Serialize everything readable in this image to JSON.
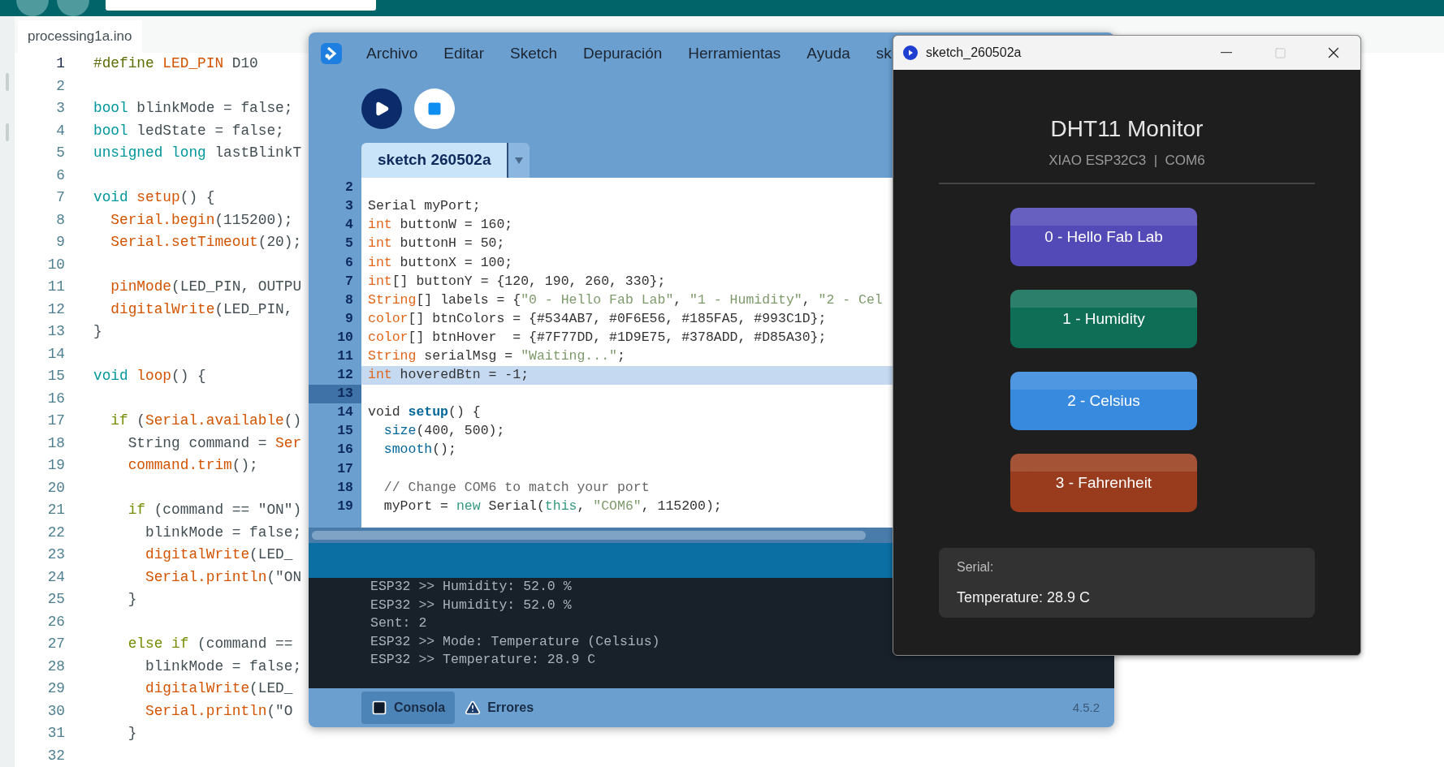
{
  "ide": {
    "file_tab": "processing1a.ino",
    "lines": [
      {
        "number": "1",
        "current": true,
        "tokens": [
          {
            "kind": "directive",
            "text": "#define"
          },
          {
            "kind": "constant",
            "text": " LED_PIN"
          },
          {
            "kind": "plain",
            "text": " D10"
          }
        ]
      },
      {
        "number": "2",
        "current": false
      },
      {
        "number": "3",
        "current": false,
        "tokens": [
          {
            "kind": "type",
            "text": "bool"
          },
          {
            "kind": "plain",
            "text": " blinkMode = false;"
          }
        ]
      },
      {
        "number": "4",
        "current": false,
        "tokens": [
          {
            "kind": "type",
            "text": "bool"
          },
          {
            "kind": "plain",
            "text": " ledState = false;"
          }
        ]
      },
      {
        "number": "5",
        "current": false,
        "tokens": [
          {
            "kind": "type",
            "text": "unsigned long"
          },
          {
            "kind": "plain",
            "text": " lastBlinkT"
          }
        ]
      },
      {
        "number": "6",
        "current": false
      },
      {
        "number": "7",
        "current": false,
        "tokens": [
          {
            "kind": "type",
            "text": "void"
          },
          {
            "kind": "function",
            "text": " setup"
          },
          {
            "kind": "plain",
            "text": "() {"
          }
        ]
      },
      {
        "number": "8",
        "current": false,
        "tokens": [
          {
            "kind": "function",
            "text": "  Serial.begin"
          },
          {
            "kind": "plain",
            "text": "(115200);"
          }
        ]
      },
      {
        "number": "9",
        "current": false,
        "tokens": [
          {
            "kind": "function",
            "text": "  Serial.setTimeout"
          },
          {
            "kind": "plain",
            "text": "(20);"
          }
        ]
      },
      {
        "number": "10",
        "current": false
      },
      {
        "number": "11",
        "current": false,
        "tokens": [
          {
            "kind": "function",
            "text": "  pinMode"
          },
          {
            "kind": "plain",
            "text": "(LED_PIN, OUTPU"
          }
        ]
      },
      {
        "number": "12",
        "current": false,
        "tokens": [
          {
            "kind": "function",
            "text": "  digitalWrite"
          },
          {
            "kind": "plain",
            "text": "(LED_PIN,"
          }
        ]
      },
      {
        "number": "13",
        "current": false,
        "tokens": [
          {
            "kind": "plain",
            "text": "}"
          }
        ]
      },
      {
        "number": "14",
        "current": false
      },
      {
        "number": "15",
        "current": false,
        "tokens": [
          {
            "kind": "type",
            "text": "void"
          },
          {
            "kind": "function",
            "text": " loop"
          },
          {
            "kind": "plain",
            "text": "() {"
          }
        ]
      },
      {
        "number": "16",
        "current": false
      },
      {
        "number": "17",
        "current": false,
        "tokens": [
          {
            "kind": "control",
            "text": "  if"
          },
          {
            "kind": "plain",
            "text": " ("
          },
          {
            "kind": "function",
            "text": "Serial.available"
          },
          {
            "kind": "plain",
            "text": "()"
          }
        ]
      },
      {
        "number": "18",
        "current": false,
        "tokens": [
          {
            "kind": "plain",
            "text": "    String command = "
          },
          {
            "kind": "function",
            "text": "Ser"
          }
        ]
      },
      {
        "number": "19",
        "current": false,
        "tokens": [
          {
            "kind": "function",
            "text": "    command.trim"
          },
          {
            "kind": "plain",
            "text": "();"
          }
        ]
      },
      {
        "number": "20",
        "current": false
      },
      {
        "number": "21",
        "current": false,
        "tokens": [
          {
            "kind": "control",
            "text": "    if"
          },
          {
            "kind": "plain",
            "text": " (command == \"ON\")"
          }
        ]
      },
      {
        "number": "22",
        "current": false,
        "tokens": [
          {
            "kind": "plain",
            "text": "      blinkMode = false;"
          }
        ]
      },
      {
        "number": "23",
        "current": false,
        "tokens": [
          {
            "kind": "function",
            "text": "      digitalWrite"
          },
          {
            "kind": "plain",
            "text": "(LED_"
          }
        ]
      },
      {
        "number": "24",
        "current": false,
        "tokens": [
          {
            "kind": "function",
            "text": "      Serial.println"
          },
          {
            "kind": "plain",
            "text": "(\"ON"
          }
        ]
      },
      {
        "number": "25",
        "current": false,
        "tokens": [
          {
            "kind": "plain",
            "text": "    }"
          }
        ]
      },
      {
        "number": "26",
        "current": false
      },
      {
        "number": "27",
        "current": false,
        "tokens": [
          {
            "kind": "control",
            "text": "    else if"
          },
          {
            "kind": "plain",
            "text": " (command =="
          }
        ]
      },
      {
        "number": "28",
        "current": false,
        "tokens": [
          {
            "kind": "plain",
            "text": "      blinkMode = false;"
          }
        ]
      },
      {
        "number": "29",
        "current": false,
        "tokens": [
          {
            "kind": "function",
            "text": "      digitalWrite"
          },
          {
            "kind": "plain",
            "text": "(LED_"
          }
        ]
      },
      {
        "number": "30",
        "current": false,
        "tokens": [
          {
            "kind": "function",
            "text": "      Serial.println"
          },
          {
            "kind": "plain",
            "text": "(\"O"
          }
        ]
      },
      {
        "number": "31",
        "current": false,
        "tokens": [
          {
            "kind": "plain",
            "text": "    }"
          }
        ]
      },
      {
        "number": "32",
        "current": false
      }
    ]
  },
  "processing": {
    "menu": [
      "Archivo",
      "Editar",
      "Sketch",
      "Depuración",
      "Herramientas",
      "Ayuda",
      "sk"
    ],
    "tab": {
      "label": "sketch 260502a",
      "selected": true
    },
    "lines": [
      {
        "number": "2",
        "highlighted": false,
        "current": false
      },
      {
        "number": "3",
        "highlighted": false,
        "current": false,
        "tokens": [
          {
            "kind": "plain",
            "text": "Serial myPort;"
          }
        ]
      },
      {
        "number": "4",
        "highlighted": false,
        "current": false,
        "tokens": [
          {
            "kind": "type",
            "text": "int"
          },
          {
            "kind": "plain",
            "text": " buttonW = 160;"
          }
        ]
      },
      {
        "number": "5",
        "highlighted": false,
        "current": false,
        "tokens": [
          {
            "kind": "type",
            "text": "int"
          },
          {
            "kind": "plain",
            "text": " buttonH = 50;"
          }
        ]
      },
      {
        "number": "6",
        "highlighted": false,
        "current": false,
        "tokens": [
          {
            "kind": "type",
            "text": "int"
          },
          {
            "kind": "plain",
            "text": " buttonX = 100;"
          }
        ]
      },
      {
        "number": "7",
        "highlighted": false,
        "current": false,
        "tokens": [
          {
            "kind": "type",
            "text": "int"
          },
          {
            "kind": "plain",
            "text": "[] buttonY = {120, 190, 260, 330};"
          }
        ]
      },
      {
        "number": "8",
        "highlighted": false,
        "current": false,
        "tokens": [
          {
            "kind": "type",
            "text": "String"
          },
          {
            "kind": "plain",
            "text": "[] labels = {"
          },
          {
            "kind": "string",
            "text": "\"0 - Hello Fab Lab\""
          },
          {
            "kind": "plain",
            "text": ", "
          },
          {
            "kind": "string",
            "text": "\"1 - Humidity\""
          },
          {
            "kind": "plain",
            "text": ", "
          },
          {
            "kind": "string",
            "text": "\"2 - Cel"
          }
        ]
      },
      {
        "number": "9",
        "highlighted": false,
        "current": false,
        "tokens": [
          {
            "kind": "type",
            "text": "color"
          },
          {
            "kind": "plain",
            "text": "[] btnColors = {#534AB7, #0F6E56, #185FA5, #993C1D};"
          }
        ]
      },
      {
        "number": "10",
        "highlighted": false,
        "current": false,
        "tokens": [
          {
            "kind": "type",
            "text": "color"
          },
          {
            "kind": "plain",
            "text": "[] btnHover  = {#7F77DD, #1D9E75, #378ADD, #D85A30};"
          }
        ]
      },
      {
        "number": "11",
        "highlighted": false,
        "current": false,
        "tokens": [
          {
            "kind": "type",
            "text": "String"
          },
          {
            "kind": "plain",
            "text": " serialMsg = "
          },
          {
            "kind": "string",
            "text": "\"Waiting...\""
          },
          {
            "kind": "plain",
            "text": ";"
          }
        ]
      },
      {
        "number": "12",
        "highlighted": true,
        "current": false,
        "tokens": [
          {
            "kind": "type",
            "text": "int"
          },
          {
            "kind": "plain",
            "text": " hoveredBtn = -1;"
          }
        ]
      },
      {
        "number": "13",
        "highlighted": false,
        "current": true
      },
      {
        "number": "14",
        "highlighted": false,
        "current": false,
        "tokens": [
          {
            "kind": "plain",
            "text": "void "
          },
          {
            "kind": "bold_function",
            "text": "setup"
          },
          {
            "kind": "plain",
            "text": "() {"
          }
        ]
      },
      {
        "number": "15",
        "highlighted": false,
        "current": false,
        "tokens": [
          {
            "kind": "function",
            "text": "  size"
          },
          {
            "kind": "plain",
            "text": "(400, 500);"
          }
        ]
      },
      {
        "number": "16",
        "highlighted": false,
        "current": false,
        "tokens": [
          {
            "kind": "function",
            "text": "  smooth"
          },
          {
            "kind": "plain",
            "text": "();"
          }
        ]
      },
      {
        "number": "17",
        "highlighted": false,
        "current": false
      },
      {
        "number": "18",
        "highlighted": false,
        "current": false,
        "tokens": [
          {
            "kind": "comment",
            "text": "  // Change COM6 to match your port"
          }
        ]
      },
      {
        "number": "19",
        "highlighted": false,
        "current": false,
        "tokens": [
          {
            "kind": "plain",
            "text": "  myPort = "
          },
          {
            "kind": "literal",
            "text": "new"
          },
          {
            "kind": "plain",
            "text": " Serial("
          },
          {
            "kind": "literal",
            "text": "this"
          },
          {
            "kind": "plain",
            "text": ", "
          },
          {
            "kind": "string",
            "text": "\"COM6\""
          },
          {
            "kind": "plain",
            "text": ", 115200);"
          }
        ]
      }
    ],
    "console": [
      "ESP32 >> Humidity: 52.0 %",
      "ESP32 >> Humidity: 52.0 %",
      "Sent: 2",
      "ESP32 >> Mode: Temperature (Celsius)",
      "ESP32 >> Temperature: 28.9 C"
    ],
    "console_tabs": [
      {
        "label": "Consola",
        "kind": "console",
        "selected": true
      },
      {
        "label": "Errores",
        "kind": "errors",
        "selected": false
      }
    ],
    "version": "4.5.2"
  },
  "sketch": {
    "title": "sketch_260502a",
    "heading": "DHT11 Monitor",
    "subtitle": "XIAO ESP32C3  |  COM6",
    "buttons": [
      {
        "label": "0 - Hello Fab Lab",
        "color": "#534ab7"
      },
      {
        "label": "1 - Humidity",
        "color": "#0f6e56"
      },
      {
        "label": "2 - Celsius",
        "color": "#378add"
      },
      {
        "label": "3 - Fahrenheit",
        "color": "#993c1d"
      }
    ],
    "serial_label": "Serial:",
    "serial_message": "Temperature: 28.9 C"
  }
}
